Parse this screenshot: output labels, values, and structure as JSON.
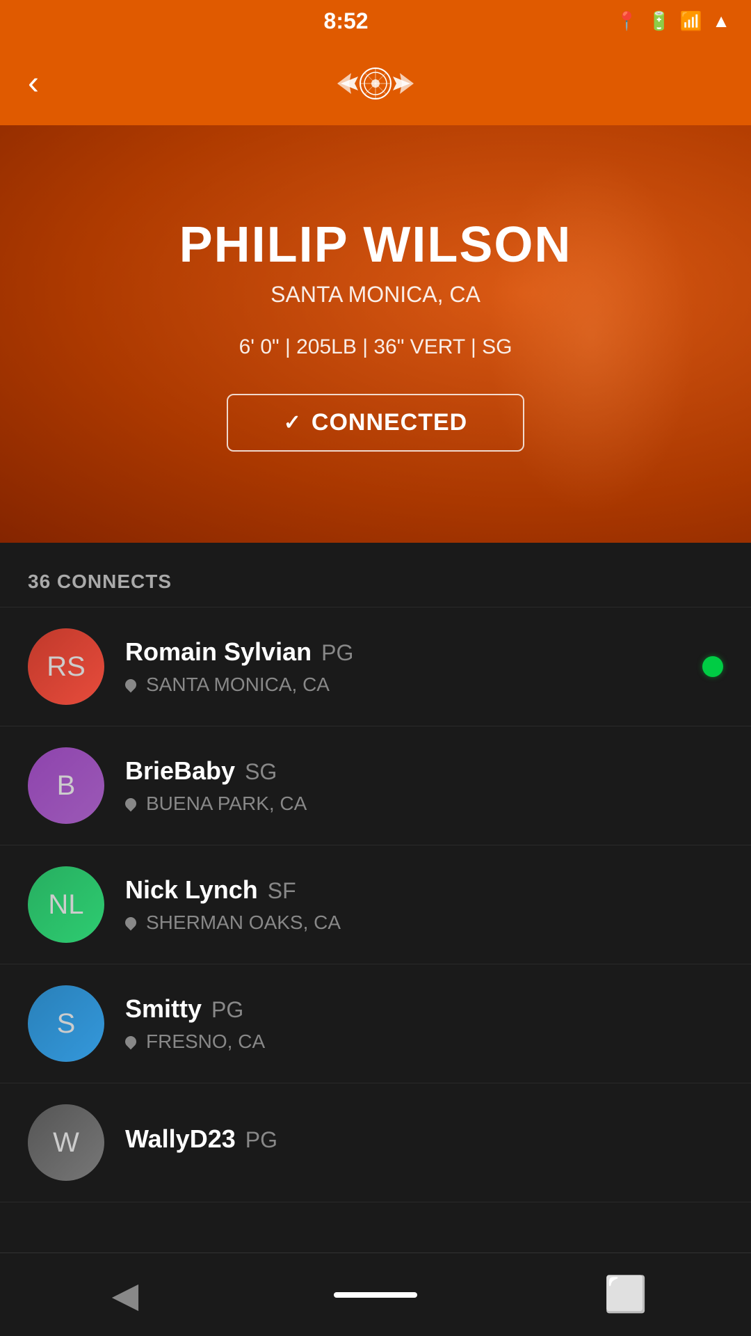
{
  "statusBar": {
    "time": "8:52",
    "icons": [
      "location",
      "battery",
      "signal",
      "wifi"
    ]
  },
  "header": {
    "backLabel": "‹",
    "logoAlt": "app-logo"
  },
  "profile": {
    "name": "PHILIP WILSON",
    "location": "SANTA MONICA, CA",
    "stats": "6' 0\" | 205LB | 36\" VERT | SG",
    "connectedLabel": "CONNECTED",
    "checkmark": "✓"
  },
  "connectsSection": {
    "label": "36 CONNECTS"
  },
  "contacts": [
    {
      "id": 1,
      "name": "Romain Sylvian",
      "position": "PG",
      "city": "SANTA MONICA, CA",
      "online": true,
      "avatarClass": "avatar-1"
    },
    {
      "id": 2,
      "name": "BrieBaby",
      "position": "SG",
      "city": "BUENA PARK, CA",
      "online": false,
      "avatarClass": "avatar-2"
    },
    {
      "id": 3,
      "name": "Nick Lynch",
      "position": "SF",
      "city": "SHERMAN OAKS, CA",
      "online": false,
      "avatarClass": "avatar-3"
    },
    {
      "id": 4,
      "name": "Smitty",
      "position": "PG",
      "city": "FRESNO, CA",
      "online": false,
      "avatarClass": "avatar-4"
    },
    {
      "id": 5,
      "name": "WallyD23",
      "position": "PG",
      "city": "",
      "online": false,
      "avatarClass": "avatar-5"
    }
  ],
  "bottomNav": {
    "backIcon": "◀",
    "homeIcon": "⬜",
    "squareIcon": "▣"
  }
}
